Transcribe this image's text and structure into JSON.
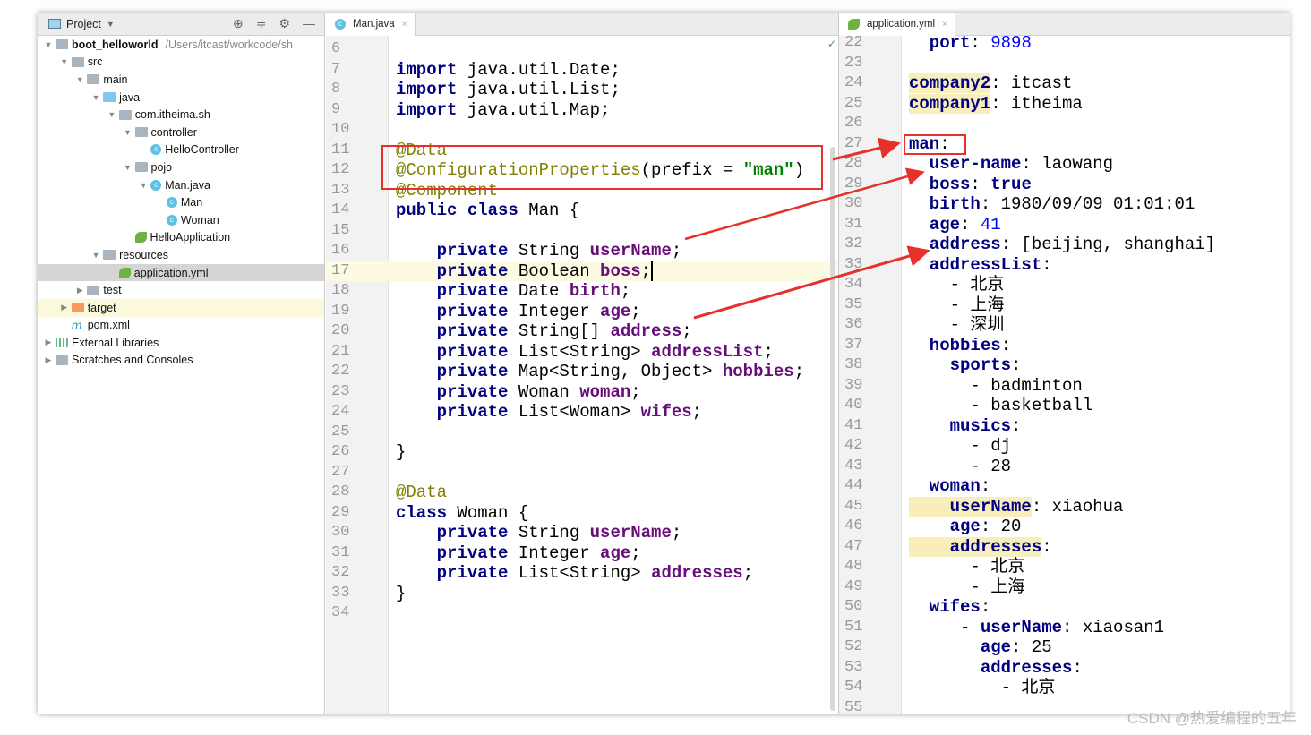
{
  "project": {
    "title": "Project",
    "tree": [
      {
        "label": "boot_helloworld",
        "path": "/Users/itcast/workcode/sh",
        "level": 0,
        "arrow": "▼",
        "icon": "module-folder-icon",
        "bold": true
      },
      {
        "label": "src",
        "level": 1,
        "arrow": "▼",
        "icon": "folder-icon"
      },
      {
        "label": "main",
        "level": 2,
        "arrow": "▼",
        "icon": "folder-icon"
      },
      {
        "label": "java",
        "level": 3,
        "arrow": "▼",
        "icon": "source-folder-icon"
      },
      {
        "label": "com.itheima.sh",
        "level": 4,
        "arrow": "▼",
        "icon": "package-icon"
      },
      {
        "label": "controller",
        "level": 5,
        "arrow": "▼",
        "icon": "package-icon"
      },
      {
        "label": "HelloController",
        "level": 6,
        "arrow": "",
        "icon": "class-icon"
      },
      {
        "label": "pojo",
        "level": 5,
        "arrow": "▼",
        "icon": "package-icon"
      },
      {
        "label": "Man.java",
        "level": 6,
        "arrow": "▼",
        "icon": "class-icon"
      },
      {
        "label": "Man",
        "level": 7,
        "arrow": "",
        "icon": "class-icon"
      },
      {
        "label": "Woman",
        "level": 7,
        "arrow": "",
        "icon": "class-icon"
      },
      {
        "label": "HelloApplication",
        "level": 5,
        "arrow": "",
        "icon": "spring-class-icon"
      },
      {
        "label": "resources",
        "level": 3,
        "arrow": "▼",
        "icon": "resources-folder-icon"
      },
      {
        "label": "application.yml",
        "level": 4,
        "arrow": "",
        "icon": "spring-yml-icon",
        "selected": true
      },
      {
        "label": "test",
        "level": 2,
        "arrow": "▶",
        "icon": "folder-icon"
      },
      {
        "label": "target",
        "level": 1,
        "arrow": "▶",
        "icon": "excluded-folder-icon",
        "highlight": true
      },
      {
        "label": "pom.xml",
        "level": 1,
        "arrow": "",
        "icon": "maven-icon"
      },
      {
        "label": "External Libraries",
        "level": 0,
        "arrow": "▶",
        "icon": "libraries-icon"
      },
      {
        "label": "Scratches and Consoles",
        "level": 0,
        "arrow": "▶",
        "icon": "scratches-icon"
      }
    ]
  },
  "java_tab": {
    "label": "Man.java",
    "close": "×"
  },
  "yml_tab": {
    "label": "application.yml",
    "close": "×"
  },
  "java_lines": [
    {
      "n": "6",
      "t": []
    },
    {
      "n": "7",
      "t": [
        [
          "import",
          "k"
        ],
        [
          " java.util.Date;",
          "t"
        ]
      ]
    },
    {
      "n": "8",
      "t": [
        [
          "import",
          "k"
        ],
        [
          " java.util.List;",
          "t"
        ]
      ]
    },
    {
      "n": "9",
      "t": [
        [
          "import",
          "k"
        ],
        [
          " java.util.Map;",
          "t"
        ]
      ]
    },
    {
      "n": "10",
      "t": []
    },
    {
      "n": "11",
      "t": [
        [
          "@Data",
          "a"
        ]
      ]
    },
    {
      "n": "12",
      "t": [
        [
          "@ConfigurationProperties",
          "a"
        ],
        [
          "(prefix = ",
          "t"
        ],
        [
          "\"man\"",
          "s"
        ],
        [
          ")",
          "t"
        ]
      ]
    },
    {
      "n": "13",
      "t": [
        [
          "@Component",
          "a"
        ]
      ]
    },
    {
      "n": "14",
      "t": [
        [
          "public class",
          "k"
        ],
        [
          " Man {",
          "t"
        ]
      ]
    },
    {
      "n": "15",
      "t": []
    },
    {
      "n": "16",
      "t": [
        [
          "    private",
          "k"
        ],
        [
          " String ",
          "t"
        ],
        [
          "userName",
          "f"
        ],
        [
          ";",
          "t"
        ]
      ]
    },
    {
      "n": "17",
      "t": [
        [
          "    private",
          "k"
        ],
        [
          " Boolean ",
          "t"
        ],
        [
          "boss",
          "f"
        ],
        [
          ";",
          "t"
        ]
      ],
      "current": true
    },
    {
      "n": "18",
      "t": [
        [
          "    private",
          "k"
        ],
        [
          " Date ",
          "t"
        ],
        [
          "birth",
          "f"
        ],
        [
          ";",
          "t"
        ]
      ]
    },
    {
      "n": "19",
      "t": [
        [
          "    private",
          "k"
        ],
        [
          " Integer ",
          "t"
        ],
        [
          "age",
          "f"
        ],
        [
          ";",
          "t"
        ]
      ]
    },
    {
      "n": "20",
      "t": [
        [
          "    private",
          "k"
        ],
        [
          " String[] ",
          "t"
        ],
        [
          "address",
          "f"
        ],
        [
          ";",
          "t"
        ]
      ]
    },
    {
      "n": "21",
      "t": [
        [
          "    private",
          "k"
        ],
        [
          " List<String> ",
          "t"
        ],
        [
          "addressList",
          "f"
        ],
        [
          ";",
          "t"
        ]
      ]
    },
    {
      "n": "22",
      "t": [
        [
          "    private",
          "k"
        ],
        [
          " Map<String, Object> ",
          "t"
        ],
        [
          "hobbies",
          "f"
        ],
        [
          ";",
          "t"
        ]
      ]
    },
    {
      "n": "23",
      "t": [
        [
          "    private",
          "k"
        ],
        [
          " Woman ",
          "t"
        ],
        [
          "woman",
          "f"
        ],
        [
          ";",
          "t"
        ]
      ]
    },
    {
      "n": "24",
      "t": [
        [
          "    private",
          "k"
        ],
        [
          " List<Woman> ",
          "t"
        ],
        [
          "wifes",
          "f"
        ],
        [
          ";",
          "t"
        ]
      ]
    },
    {
      "n": "25",
      "t": []
    },
    {
      "n": "26",
      "t": [
        [
          "}",
          "t"
        ]
      ]
    },
    {
      "n": "27",
      "t": []
    },
    {
      "n": "28",
      "t": [
        [
          "@Data",
          "a"
        ]
      ]
    },
    {
      "n": "29",
      "t": [
        [
          "class",
          "k"
        ],
        [
          " Woman {",
          "t"
        ]
      ]
    },
    {
      "n": "30",
      "t": [
        [
          "    private",
          "k"
        ],
        [
          " String ",
          "t"
        ],
        [
          "userName",
          "f"
        ],
        [
          ";",
          "t"
        ]
      ]
    },
    {
      "n": "31",
      "t": [
        [
          "    private",
          "k"
        ],
        [
          " Integer ",
          "t"
        ],
        [
          "age",
          "f"
        ],
        [
          ";",
          "t"
        ]
      ]
    },
    {
      "n": "32",
      "t": [
        [
          "    private",
          "k"
        ],
        [
          " List<String> ",
          "t"
        ],
        [
          "addresses",
          "f"
        ],
        [
          ";",
          "t"
        ]
      ]
    },
    {
      "n": "33",
      "t": [
        [
          "}",
          "t"
        ]
      ]
    },
    {
      "n": "34",
      "t": []
    }
  ],
  "yml_lines": [
    {
      "n": "22",
      "t": [
        [
          "  port",
          "y"
        ],
        [
          ": ",
          "t"
        ],
        [
          "9898",
          "n"
        ]
      ]
    },
    {
      "n": "23",
      "t": []
    },
    {
      "n": "24",
      "t": [
        [
          "company2",
          "yh"
        ],
        [
          ": itcast",
          "t"
        ]
      ]
    },
    {
      "n": "25",
      "t": [
        [
          "company1",
          "yh"
        ],
        [
          ": itheima",
          "t"
        ]
      ]
    },
    {
      "n": "26",
      "t": []
    },
    {
      "n": "27",
      "t": [
        [
          "man",
          "y"
        ],
        [
          ":",
          "t"
        ]
      ]
    },
    {
      "n": "28",
      "t": [
        [
          "  user-name",
          "y"
        ],
        [
          ": laowang",
          "t"
        ]
      ]
    },
    {
      "n": "29",
      "t": [
        [
          "  boss",
          "y"
        ],
        [
          ": ",
          "t"
        ],
        [
          "true",
          "k"
        ]
      ]
    },
    {
      "n": "30",
      "t": [
        [
          "  birth",
          "y"
        ],
        [
          ": 1980/09/09 01:01:01",
          "t"
        ]
      ]
    },
    {
      "n": "31",
      "t": [
        [
          "  age",
          "y"
        ],
        [
          ": ",
          "t"
        ],
        [
          "41",
          "n"
        ]
      ]
    },
    {
      "n": "32",
      "t": [
        [
          "  address",
          "y"
        ],
        [
          ": [beijing, shanghai]",
          "t"
        ]
      ]
    },
    {
      "n": "33",
      "t": [
        [
          "  addressList",
          "y"
        ],
        [
          ":",
          "t"
        ]
      ]
    },
    {
      "n": "34",
      "t": [
        [
          "    - 北京",
          "t"
        ]
      ]
    },
    {
      "n": "35",
      "t": [
        [
          "    - 上海",
          "t"
        ]
      ]
    },
    {
      "n": "36",
      "t": [
        [
          "    - 深圳",
          "t"
        ]
      ]
    },
    {
      "n": "37",
      "t": [
        [
          "  hobbies",
          "y"
        ],
        [
          ":",
          "t"
        ]
      ]
    },
    {
      "n": "38",
      "t": [
        [
          "    sports",
          "y"
        ],
        [
          ":",
          "t"
        ]
      ]
    },
    {
      "n": "39",
      "t": [
        [
          "      - badminton",
          "t"
        ]
      ]
    },
    {
      "n": "40",
      "t": [
        [
          "      - basketball",
          "t"
        ]
      ]
    },
    {
      "n": "41",
      "t": [
        [
          "    musics",
          "y"
        ],
        [
          ":",
          "t"
        ]
      ]
    },
    {
      "n": "42",
      "t": [
        [
          "      - dj",
          "t"
        ]
      ]
    },
    {
      "n": "43",
      "t": [
        [
          "      - ",
          "t"
        ],
        [
          "28",
          "t"
        ]
      ]
    },
    {
      "n": "44",
      "t": [
        [
          "  woman",
          "y"
        ],
        [
          ":",
          "t"
        ]
      ]
    },
    {
      "n": "45",
      "t": [
        [
          "    userName",
          "yh"
        ],
        [
          ": xiaohua",
          "t"
        ]
      ]
    },
    {
      "n": "46",
      "t": [
        [
          "    age",
          "y"
        ],
        [
          ": 20",
          "t"
        ]
      ]
    },
    {
      "n": "47",
      "t": [
        [
          "    addresses",
          "yh"
        ],
        [
          ":",
          "t"
        ]
      ]
    },
    {
      "n": "48",
      "t": [
        [
          "      - 北京",
          "t"
        ]
      ]
    },
    {
      "n": "49",
      "t": [
        [
          "      - 上海",
          "t"
        ]
      ]
    },
    {
      "n": "50",
      "t": [
        [
          "  wifes",
          "y"
        ],
        [
          ":",
          "t"
        ]
      ]
    },
    {
      "n": "51",
      "t": [
        [
          "     - ",
          "t"
        ],
        [
          "userName",
          "y"
        ],
        [
          ": xiaosan1",
          "t"
        ]
      ]
    },
    {
      "n": "52",
      "t": [
        [
          "       age",
          "y"
        ],
        [
          ": 25",
          "t"
        ]
      ]
    },
    {
      "n": "53",
      "t": [
        [
          "       addresses",
          "y"
        ],
        [
          ":",
          "t"
        ]
      ]
    },
    {
      "n": "54",
      "t": [
        [
          "         - 北京",
          "t"
        ]
      ]
    },
    {
      "n": "55",
      "t": []
    }
  ],
  "colors": {
    "annotation_box": "#e8302a",
    "keyword": "#000080",
    "field": "#660e7a",
    "annotation": "#808000",
    "string": "#008000",
    "number": "#0000ff"
  },
  "watermark": "CSDN @热爱编程的五年"
}
